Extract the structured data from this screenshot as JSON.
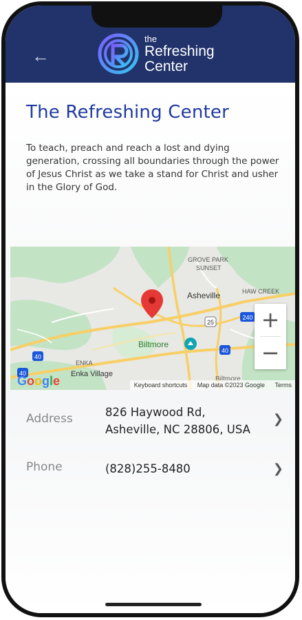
{
  "header": {
    "logo_small": "the",
    "logo_line1": "Refreshing",
    "logo_line2": "Center"
  },
  "page": {
    "title": "The Refreshing Center",
    "description": "To teach, preach and reach a lost and dying generation, crossing all boundaries through the power of Jesus Christ as we take a stand for Christ and usher in the Glory of God."
  },
  "map": {
    "labels": {
      "grove_park_1": "GROVE PARK",
      "grove_park_2": "SUNSET",
      "asheville": "Asheville",
      "haw_creek": "HAW CREEK",
      "biltmore": "Biltmore",
      "enka": "ENKA",
      "enka_village": "Enka Village",
      "biltmore_forest": "Biltmore",
      "route_25": "25",
      "route_240": "240",
      "route_40a": "40",
      "route_40b": "40",
      "route_40c": "40"
    },
    "zoom_in": "+",
    "zoom_out": "−",
    "google": [
      "G",
      "o",
      "o",
      "g",
      "l",
      "e"
    ],
    "google_colors": [
      "#4285F4",
      "#EA4335",
      "#FBBC05",
      "#4285F4",
      "#34A853",
      "#EA4335"
    ],
    "attribution": {
      "shortcuts": "Keyboard shortcuts",
      "data": "Map data ©2023 Google",
      "terms": "Terms"
    }
  },
  "details": {
    "address_label": "Address",
    "address_line1": "826 Haywood Rd,",
    "address_line2": "Asheville, NC 28806, USA",
    "phone_label": "Phone",
    "phone_value": "(828)255-8480"
  },
  "icons": {
    "back": "arrow-left-icon",
    "chevron": "chevron-right-icon",
    "pin": "map-pin-icon"
  },
  "colors": {
    "header_bg": "#22336b",
    "title": "#1f3aa0",
    "pin": "#e53935",
    "map_green": "#c3e3c5",
    "map_road": "#f8cf66"
  }
}
